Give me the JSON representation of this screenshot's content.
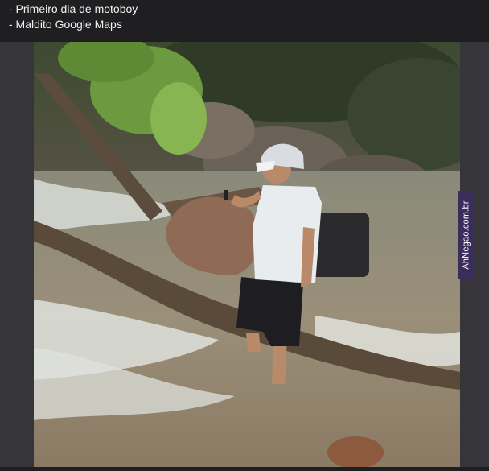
{
  "caption": {
    "lines": [
      "- Primeiro dia de motoboy",
      "- Maldito Google Maps"
    ]
  },
  "watermark": {
    "text": "AhNegao.com.br"
  },
  "colors": {
    "caption_bg": "#1f1f21",
    "frame_bg": "#35353a",
    "watermark_bg": "#3a2d5c"
  }
}
